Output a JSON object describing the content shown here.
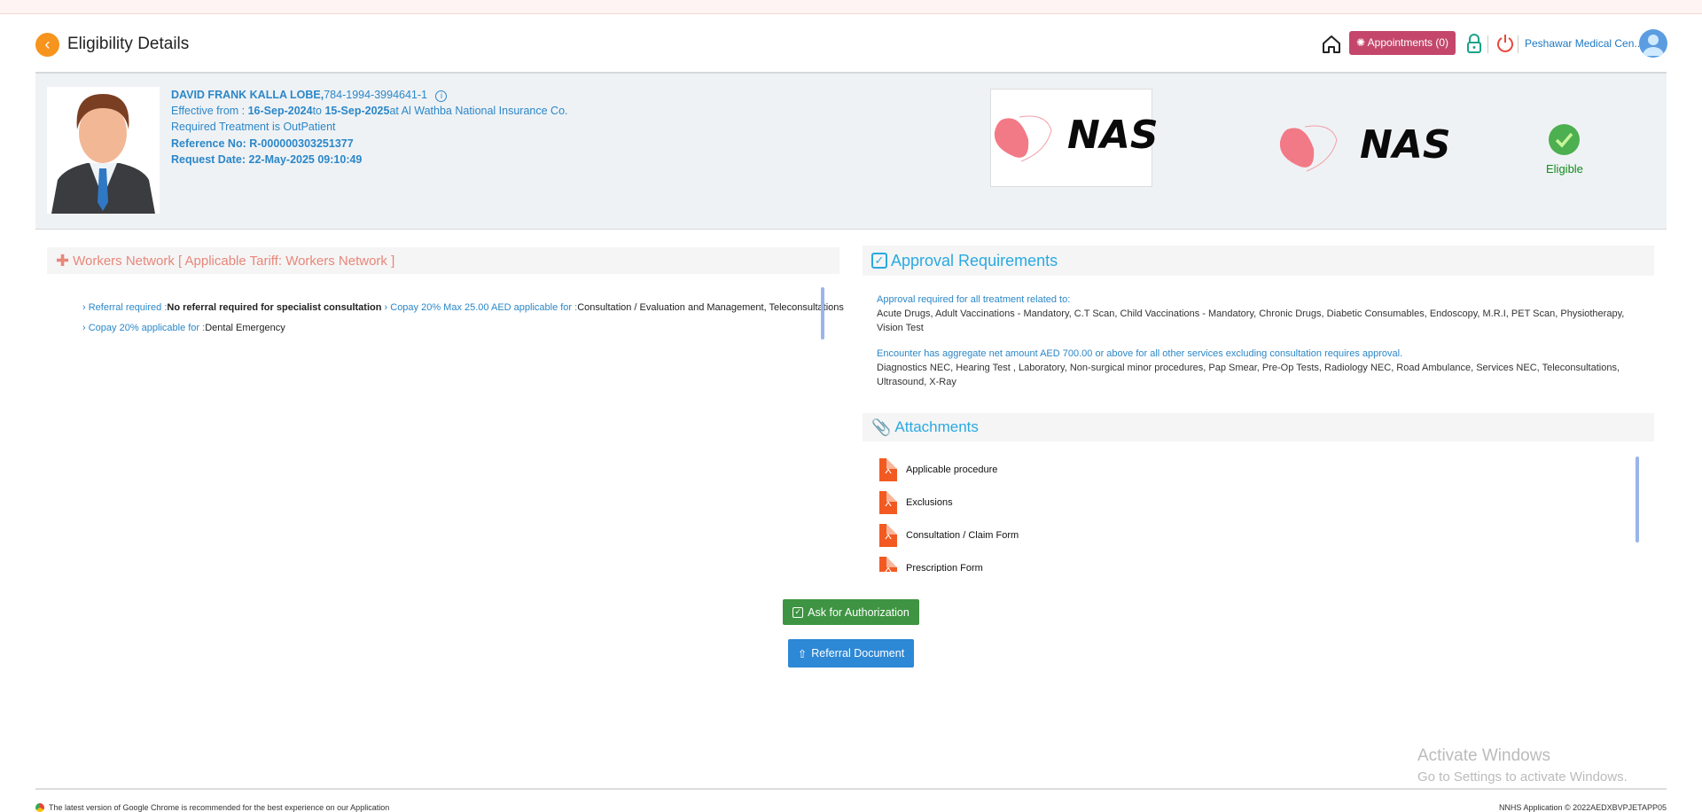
{
  "header": {
    "title": "Eligibility Details",
    "appointments_label": "Appointments (0)",
    "organization": "Peshawar Medical Cen..."
  },
  "patient": {
    "name": "DAVID FRANK KALLA LOBE,",
    "id": "784-1994-3994641-1",
    "effective_prefix": "Effective from : ",
    "from": "16-Sep-2024",
    "to_word": "to ",
    "to": "15-Sep-2025",
    "insurer": "at Al Wathba National Insurance Co.",
    "treatment": "Required Treatment is OutPatient",
    "reference": "Reference No: R-000000303251377",
    "request_date": "Request Date: 22-May-2025 09:10:49"
  },
  "payer": {
    "logo_text": "NAS",
    "status": "Eligible"
  },
  "network": {
    "title": "Workers Network [ Applicable Tariff: Workers Network ]",
    "rules": [
      {
        "label": "Referral required :",
        "value": "No referral required for specialist consultation"
      },
      {
        "label": "Copay 20% Max 25.00 AED applicable for :",
        "value": "Consultation / Evaluation and Management, Teleconsultations"
      },
      {
        "label": "Copay 20% applicable for :",
        "value": "Dental Emergency"
      }
    ]
  },
  "approval": {
    "title": "Approval Requirements",
    "groups": [
      {
        "heading": "Approval required for all treatment related to:",
        "items": "Acute Drugs, Adult Vaccinations - Mandatory, C.T Scan, Child Vaccinations - Mandatory, Chronic Drugs, Diabetic Consumables, Endoscopy, M.R.I, PET Scan, Physiotherapy, Vision Test"
      },
      {
        "heading": "Encounter has aggregate net amount AED 700.00 or above for all other services excluding consultation requires approval.",
        "items": "Diagnostics NEC, Hearing Test , Laboratory, Non-surgical minor procedures, Pap Smear, Pre-Op Tests, Radiology NEC, Road Ambulance, Services NEC, Teleconsultations, Ultrasound, X-Ray"
      }
    ]
  },
  "attachments": {
    "title": "Attachments",
    "items": [
      "Applicable procedure",
      "Exclusions",
      "Consultation / Claim Form",
      "Prescription Form"
    ]
  },
  "actions": {
    "ask_auth": "Ask for Authorization",
    "referral_doc": "Referral Document"
  },
  "watermark": {
    "line1": "Activate Windows",
    "line2": "Go to Settings to activate Windows."
  },
  "footer": {
    "left": "The latest version of Google Chrome is recommended for the best experience on our Application",
    "right": "NNHS Application © 2022AEDXBVPJETAPP05"
  },
  "colors": {
    "accent_orange": "#f7941d",
    "appointments": "#c4476b",
    "success": "#3e9442",
    "primary": "#2d88d6"
  }
}
